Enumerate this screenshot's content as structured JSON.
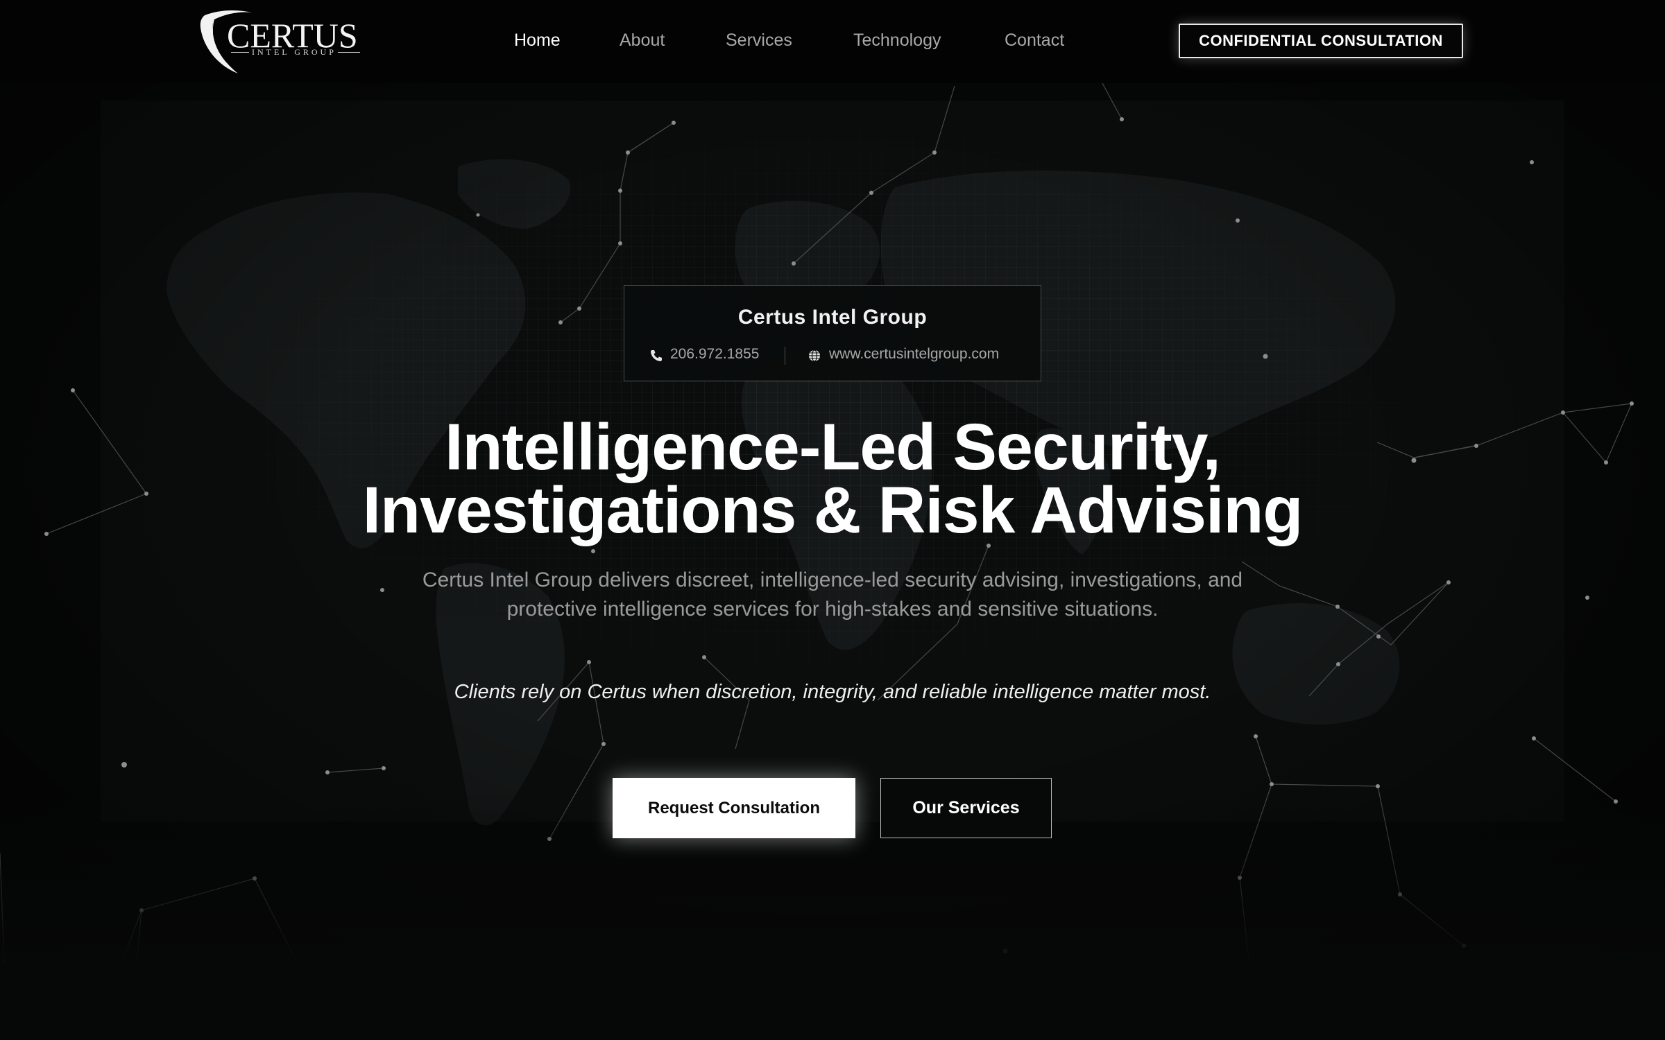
{
  "brand": {
    "name": "CERTUS",
    "tagline": "INTEL GROUP",
    "logo_icon": "shield-swoosh-icon"
  },
  "nav": {
    "items": [
      {
        "label": "Home",
        "active": true
      },
      {
        "label": "About",
        "active": false
      },
      {
        "label": "Services",
        "active": false
      },
      {
        "label": "Technology",
        "active": false
      },
      {
        "label": "Contact",
        "active": false
      }
    ],
    "cta_label": "CONFIDENTIAL CONSULTATION"
  },
  "contact_card": {
    "title": "Certus Intel Group",
    "phone": "206.972.1855",
    "phone_icon": "phone-icon",
    "website": "www.certusintelgroup.com",
    "website_icon": "globe-icon"
  },
  "hero": {
    "headline_line1": "Intelligence-Led Security,",
    "headline_line2": "Investigations & Risk Advising",
    "description": "Certus Intel Group delivers discreet, intelligence-led security advising, investigations, and protective intelligence services for high-stakes and sensitive situations.",
    "tagline": "Clients rely on Certus when discretion, integrity, and reliable intelligence matter most.",
    "primary_button": "Request Consultation",
    "secondary_button": "Our Services"
  },
  "colors": {
    "background": "#060707",
    "header": "#030303",
    "text_primary": "#ffffff",
    "text_muted": "#9a9a9a",
    "accent": "#ffffff"
  }
}
